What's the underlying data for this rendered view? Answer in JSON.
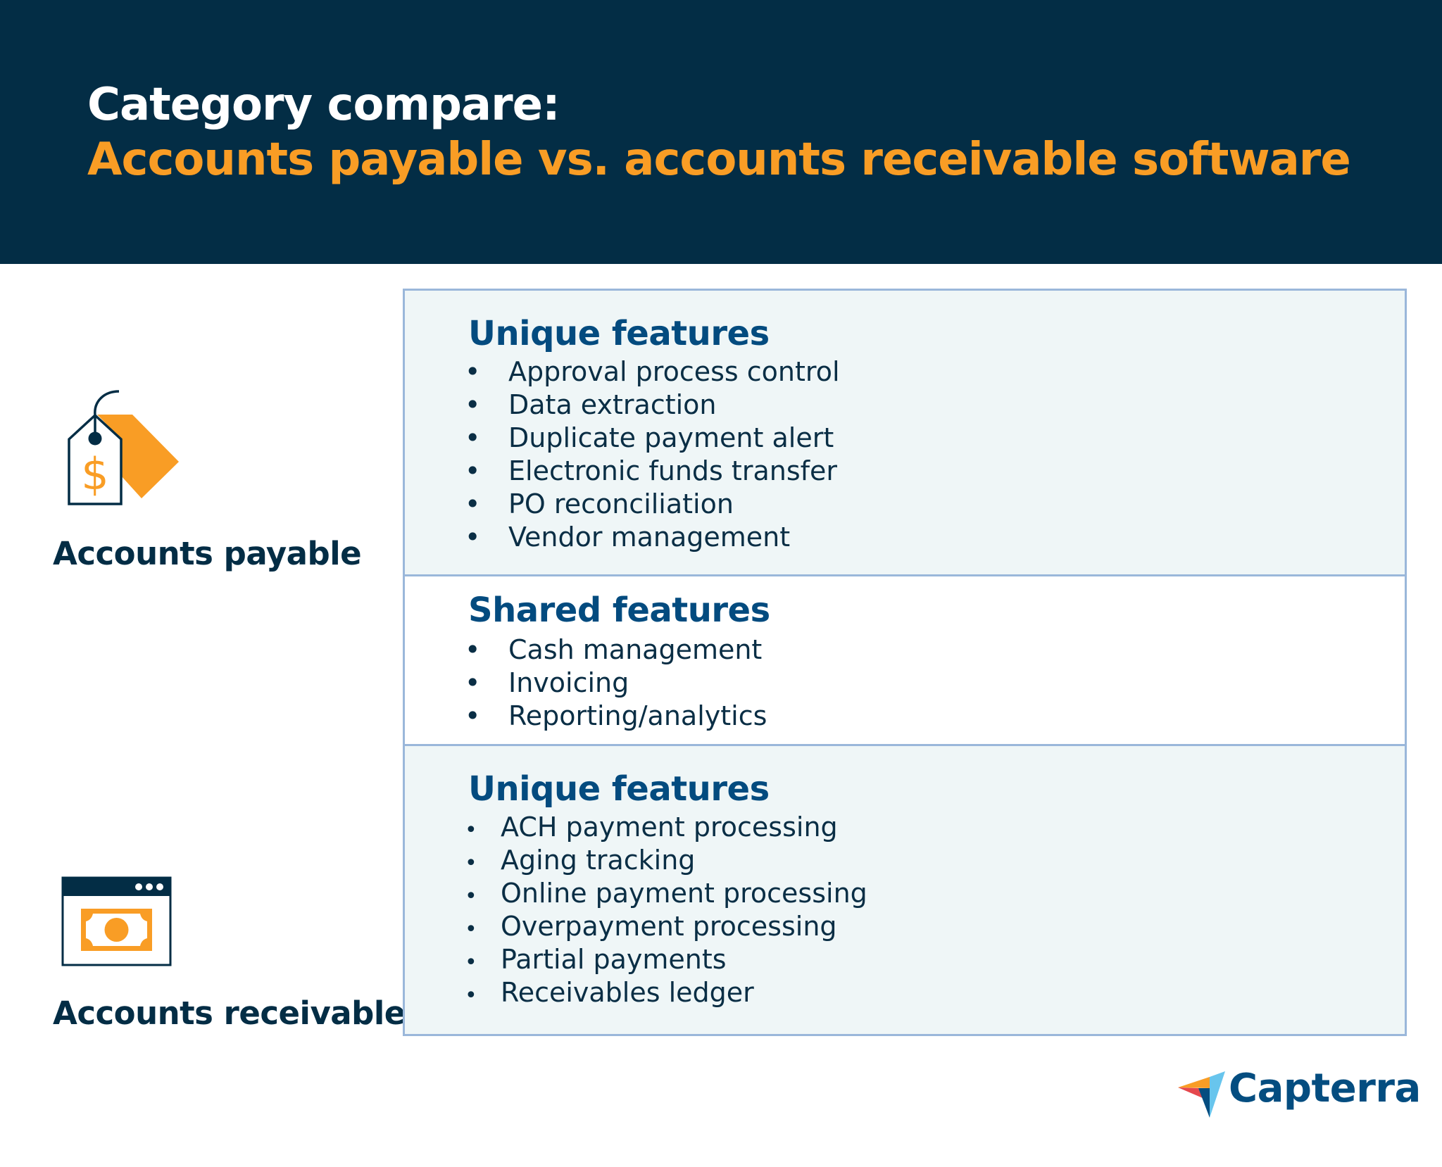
{
  "header": {
    "title_line1": "Category compare:",
    "title_line2": "Accounts payable vs. accounts receivable software",
    "background_color": "#032d45",
    "accent_color": "#f99d25"
  },
  "categories": [
    {
      "label": "Accounts payable",
      "icon": "price-tag-dollar-icon"
    },
    {
      "label": "Accounts receivable",
      "icon": "browser-window-money-icon"
    }
  ],
  "sections": [
    {
      "heading": "Unique features",
      "belongs_to": "Accounts payable",
      "items": [
        "Approval process control",
        "Data extraction",
        "Duplicate payment alert",
        "Electronic funds transfer",
        "PO reconciliation",
        "Vendor management"
      ]
    },
    {
      "heading": "Shared features",
      "belongs_to": "Both",
      "items": [
        "Cash management",
        "Invoicing",
        "Reporting/analytics"
      ]
    },
    {
      "heading": "Unique features",
      "belongs_to": "Accounts receivable",
      "items": [
        "ACH payment processing",
        "Aging tracking",
        "Online payment processing",
        "Overpayment processing",
        "Partial payments",
        "Receivables ledger"
      ]
    }
  ],
  "bullet": "•",
  "brand": {
    "name": "Capterra",
    "icon": "capterra-logo-icon",
    "color": "#044d80"
  }
}
